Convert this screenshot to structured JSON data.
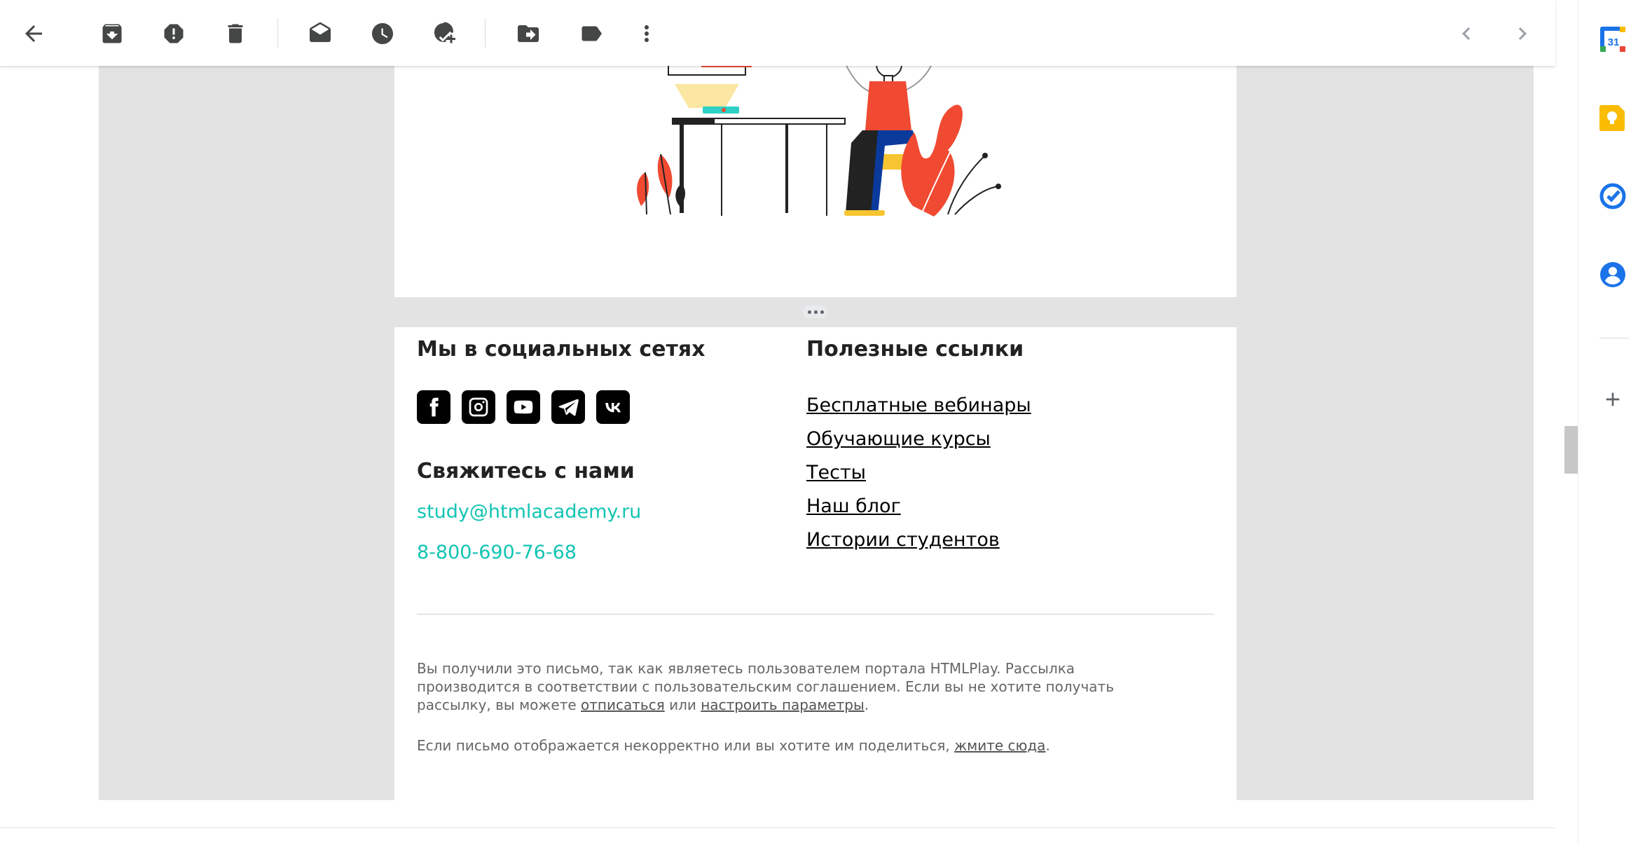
{
  "toolbar": {
    "icons": [
      "back-arrow-icon",
      "archive-icon",
      "report-spam-icon",
      "delete-icon",
      "mark-unread-icon",
      "snooze-icon",
      "add-to-tasks-icon",
      "move-to-icon",
      "label-icon",
      "more-vert-icon",
      "newer-chevron-icon",
      "older-chevron-icon"
    ]
  },
  "footer": {
    "social_heading": "Мы в социальных сетях",
    "social_networks": [
      "facebook",
      "instagram",
      "youtube",
      "telegram",
      "vk"
    ],
    "contact_heading": "Свяжитесь с нами",
    "email": "study@htmlacademy.ru",
    "phone": "8-800-690-76-68",
    "links_heading": "Полезные ссылки",
    "links": [
      "Бесплатные вебинары",
      "Обучающие курсы",
      "Тесты",
      "Наш блог",
      "Истории студентов"
    ],
    "legal1_a": "Вы получили это письмо, так как являетесь пользователем портала HTMLPlay. Рассылка производится в соответствии с пользовательским соглашением. Если вы не хотите получать рассылку, вы можете ",
    "unsubscribe": "отписаться",
    "legal1_or": " или ",
    "settings": "настроить параметры",
    "legal1_end": ".",
    "legal2_a": "Если письмо отображается некорректно или вы хотите им поделиться, ",
    "click_here": "жмите сюда",
    "legal2_end": "."
  },
  "sidepanel": {
    "calendar_day": "31",
    "apps": [
      "calendar-icon",
      "keep-icon",
      "tasks-icon",
      "contacts-icon",
      "add-icon"
    ]
  },
  "colors": {
    "accent": "#12c4b3",
    "illustration_red": "#f04a32",
    "illustration_blue": "#0a3a9c",
    "gray_bg": "#e3e3e3"
  }
}
